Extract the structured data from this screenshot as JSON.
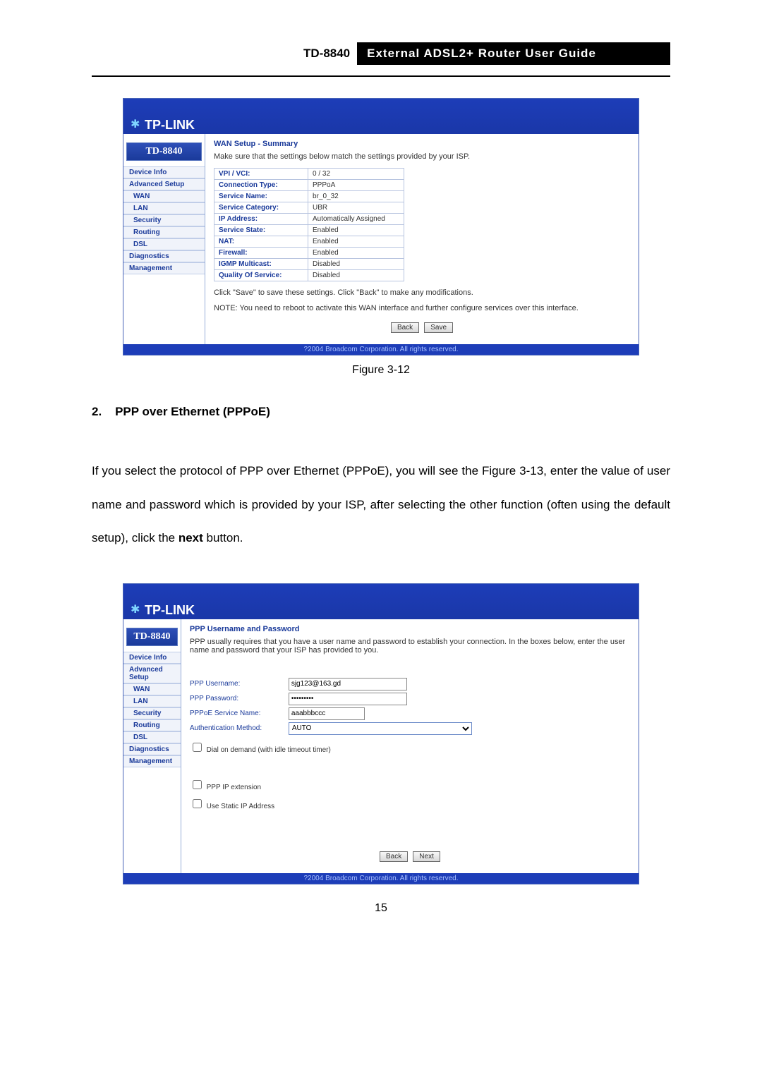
{
  "header": {
    "model": "TD-8840",
    "title": "External ADSL2+ Router User Guide"
  },
  "figure1_caption": "Figure 3-12",
  "section_number": "2.",
  "section_title": "PPP over Ethernet (PPPoE)",
  "body_paragraph_1": "If you select the protocol of PPP over Ethernet (PPPoE), you will see the Figure 3-13, enter the value of user name and password which is provided by your ISP, after selecting the other function (often using the default setup), click the ",
  "body_paragraph_bold": "next",
  "body_paragraph_tail": " button.",
  "page_number": "15",
  "brand": "TP-LINK",
  "device_model": "TD-8840",
  "nav": {
    "device_info": "Device Info",
    "advanced_setup": "Advanced Setup",
    "wan": "WAN",
    "lan": "LAN",
    "security": "Security",
    "routing": "Routing",
    "dsl": "DSL",
    "diagnostics": "Diagnostics",
    "management": "Management"
  },
  "ss1": {
    "title": "WAN Setup - Summary",
    "instruction": "Make sure that the settings below match the settings provided by your ISP.",
    "rows": {
      "vpi_label": "VPI / VCI:",
      "vpi_value": "0 / 32",
      "ct_label": "Connection Type:",
      "ct_value": "PPPoA",
      "sn_label": "Service Name:",
      "sn_value": "br_0_32",
      "sc_label": "Service Category:",
      "sc_value": "UBR",
      "ip_label": "IP Address:",
      "ip_value": "Automatically Assigned",
      "ss_label": "Service State:",
      "ss_value": "Enabled",
      "nat_label": "NAT:",
      "nat_value": "Enabled",
      "fw_label": "Firewall:",
      "fw_value": "Enabled",
      "igmp_label": "IGMP Multicast:",
      "igmp_value": "Disabled",
      "qos_label": "Quality Of Service:",
      "qos_value": "Disabled"
    },
    "note1": "Click \"Save\" to save these settings. Click \"Back\" to make any modifications.",
    "note2": "NOTE: You need to reboot to activate this WAN interface and further configure services over this interface.",
    "back_btn": "Back",
    "save_btn": "Save",
    "footer": "?2004 Broadcom Corporation. All rights reserved."
  },
  "ss2": {
    "title": "PPP Username and Password",
    "instruction": "PPP usually requires that you have a user name and password to establish your connection. In the boxes below, enter the user name and password that your ISP has provided to you.",
    "user_label": "PPP Username:",
    "user_value": "sjg123@163.gd",
    "pass_label": "PPP Password:",
    "pass_value": "•••••••••",
    "svc_label": "PPPoE Service Name:",
    "svc_value": "aaabbbccc",
    "auth_label": "Authentication Method:",
    "auth_value": "AUTO",
    "cb1": "Dial on demand (with idle timeout timer)",
    "cb2": "PPP IP extension",
    "cb3": "Use Static IP Address",
    "back_btn": "Back",
    "next_btn": "Next",
    "footer": "?2004 Broadcom Corporation. All rights reserved."
  }
}
